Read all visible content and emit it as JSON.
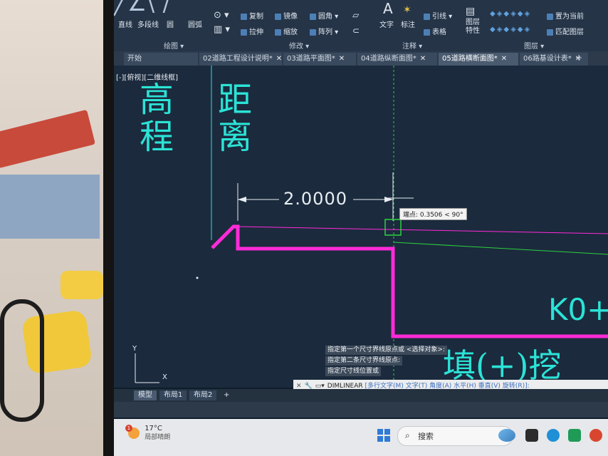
{
  "ribbon": {
    "draw_tools": [
      "直线",
      "多段线",
      "圆",
      "圆弧"
    ],
    "modify_tools": {
      "row1": [
        "复制",
        "镜像",
        "圆角"
      ],
      "row2": [
        "拉伸",
        "缩放",
        "阵列"
      ]
    },
    "annotate_tools": [
      "文字",
      "标注",
      "引线",
      "表格"
    ],
    "layer_tools": [
      "图层特性",
      "置为当前",
      "匹配图层"
    ],
    "panels": [
      "绘图",
      "修改",
      "注释",
      "图层"
    ]
  },
  "tabs": [
    {
      "label": "开始",
      "active": false,
      "closable": false
    },
    {
      "label": "02道路工程设计说明*",
      "active": false,
      "closable": true
    },
    {
      "label": "03道路平面图*",
      "active": false,
      "closable": true
    },
    {
      "label": "04道路纵断面图*",
      "active": false,
      "closable": true
    },
    {
      "label": "05道路横断面图*",
      "active": true,
      "closable": true
    },
    {
      "label": "06路基设计表*",
      "active": false,
      "closable": true
    }
  ],
  "canvas": {
    "view_label": "[-][俯视][二维线框]",
    "heading_elev": "高程",
    "heading_dist": "距离",
    "dimension_value": "2.0000",
    "tooltip": "端点: 0.3506 < 90°",
    "station_text": "K0+",
    "fill_cut_text": "填(+)挖",
    "ucs_x": "X",
    "ucs_y": "Y"
  },
  "command_history": [
    "指定第一个尺寸界线原点或 <选择对象>:",
    "指定第二条尺寸界线原点:",
    "指定尺寸线位置或"
  ],
  "command_line": {
    "command": "DIMLINEAR",
    "options": "[多行文字(M) 文字(T) 角度(A) 水平(H) 垂直(V) 旋转(R)]:"
  },
  "layout_tabs": [
    "模型",
    "布局1",
    "布局2"
  ],
  "taskbar": {
    "temperature": "17°C",
    "weather": "局部晴朗",
    "search_placeholder": "搜索",
    "notification_count": "1"
  },
  "colors": {
    "cad_cyan": "#2be3d6",
    "cad_magenta": "#ff2bd8",
    "cad_green": "#2dd13f",
    "canvas_bg": "#1b2a3d"
  }
}
